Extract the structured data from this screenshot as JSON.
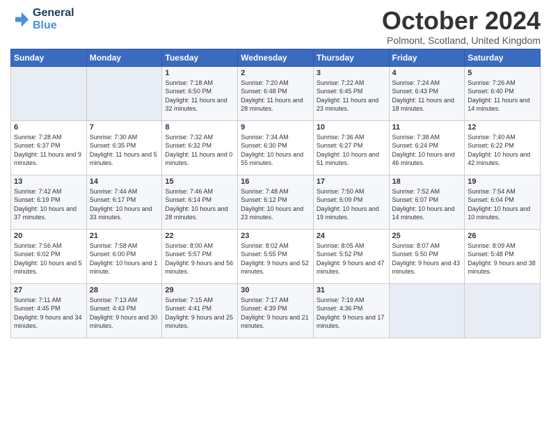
{
  "logo": {
    "line1": "General",
    "line2": "Blue"
  },
  "title": "October 2024",
  "subtitle": "Polmont, Scotland, United Kingdom",
  "weekdays": [
    "Sunday",
    "Monday",
    "Tuesday",
    "Wednesday",
    "Thursday",
    "Friday",
    "Saturday"
  ],
  "weeks": [
    [
      {
        "day": "",
        "empty": true
      },
      {
        "day": "",
        "empty": true
      },
      {
        "day": "1",
        "sunrise": "Sunrise: 7:18 AM",
        "sunset": "Sunset: 6:50 PM",
        "daylight": "Daylight: 11 hours and 32 minutes."
      },
      {
        "day": "2",
        "sunrise": "Sunrise: 7:20 AM",
        "sunset": "Sunset: 6:48 PM",
        "daylight": "Daylight: 11 hours and 28 minutes."
      },
      {
        "day": "3",
        "sunrise": "Sunrise: 7:22 AM",
        "sunset": "Sunset: 6:45 PM",
        "daylight": "Daylight: 11 hours and 23 minutes."
      },
      {
        "day": "4",
        "sunrise": "Sunrise: 7:24 AM",
        "sunset": "Sunset: 6:43 PM",
        "daylight": "Daylight: 11 hours and 18 minutes."
      },
      {
        "day": "5",
        "sunrise": "Sunrise: 7:26 AM",
        "sunset": "Sunset: 6:40 PM",
        "daylight": "Daylight: 11 hours and 14 minutes."
      }
    ],
    [
      {
        "day": "6",
        "sunrise": "Sunrise: 7:28 AM",
        "sunset": "Sunset: 6:37 PM",
        "daylight": "Daylight: 11 hours and 9 minutes."
      },
      {
        "day": "7",
        "sunrise": "Sunrise: 7:30 AM",
        "sunset": "Sunset: 6:35 PM",
        "daylight": "Daylight: 11 hours and 5 minutes."
      },
      {
        "day": "8",
        "sunrise": "Sunrise: 7:32 AM",
        "sunset": "Sunset: 6:32 PM",
        "daylight": "Daylight: 11 hours and 0 minutes."
      },
      {
        "day": "9",
        "sunrise": "Sunrise: 7:34 AM",
        "sunset": "Sunset: 6:30 PM",
        "daylight": "Daylight: 10 hours and 55 minutes."
      },
      {
        "day": "10",
        "sunrise": "Sunrise: 7:36 AM",
        "sunset": "Sunset: 6:27 PM",
        "daylight": "Daylight: 10 hours and 51 minutes."
      },
      {
        "day": "11",
        "sunrise": "Sunrise: 7:38 AM",
        "sunset": "Sunset: 6:24 PM",
        "daylight": "Daylight: 10 hours and 46 minutes."
      },
      {
        "day": "12",
        "sunrise": "Sunrise: 7:40 AM",
        "sunset": "Sunset: 6:22 PM",
        "daylight": "Daylight: 10 hours and 42 minutes."
      }
    ],
    [
      {
        "day": "13",
        "sunrise": "Sunrise: 7:42 AM",
        "sunset": "Sunset: 6:19 PM",
        "daylight": "Daylight: 10 hours and 37 minutes."
      },
      {
        "day": "14",
        "sunrise": "Sunrise: 7:44 AM",
        "sunset": "Sunset: 6:17 PM",
        "daylight": "Daylight: 10 hours and 33 minutes."
      },
      {
        "day": "15",
        "sunrise": "Sunrise: 7:46 AM",
        "sunset": "Sunset: 6:14 PM",
        "daylight": "Daylight: 10 hours and 28 minutes."
      },
      {
        "day": "16",
        "sunrise": "Sunrise: 7:48 AM",
        "sunset": "Sunset: 6:12 PM",
        "daylight": "Daylight: 10 hours and 23 minutes."
      },
      {
        "day": "17",
        "sunrise": "Sunrise: 7:50 AM",
        "sunset": "Sunset: 6:09 PM",
        "daylight": "Daylight: 10 hours and 19 minutes."
      },
      {
        "day": "18",
        "sunrise": "Sunrise: 7:52 AM",
        "sunset": "Sunset: 6:07 PM",
        "daylight": "Daylight: 10 hours and 14 minutes."
      },
      {
        "day": "19",
        "sunrise": "Sunrise: 7:54 AM",
        "sunset": "Sunset: 6:04 PM",
        "daylight": "Daylight: 10 hours and 10 minutes."
      }
    ],
    [
      {
        "day": "20",
        "sunrise": "Sunrise: 7:56 AM",
        "sunset": "Sunset: 6:02 PM",
        "daylight": "Daylight: 10 hours and 5 minutes."
      },
      {
        "day": "21",
        "sunrise": "Sunrise: 7:58 AM",
        "sunset": "Sunset: 6:00 PM",
        "daylight": "Daylight: 10 hours and 1 minute."
      },
      {
        "day": "22",
        "sunrise": "Sunrise: 8:00 AM",
        "sunset": "Sunset: 5:57 PM",
        "daylight": "Daylight: 9 hours and 56 minutes."
      },
      {
        "day": "23",
        "sunrise": "Sunrise: 8:02 AM",
        "sunset": "Sunset: 5:55 PM",
        "daylight": "Daylight: 9 hours and 52 minutes."
      },
      {
        "day": "24",
        "sunrise": "Sunrise: 8:05 AM",
        "sunset": "Sunset: 5:52 PM",
        "daylight": "Daylight: 9 hours and 47 minutes."
      },
      {
        "day": "25",
        "sunrise": "Sunrise: 8:07 AM",
        "sunset": "Sunset: 5:50 PM",
        "daylight": "Daylight: 9 hours and 43 minutes."
      },
      {
        "day": "26",
        "sunrise": "Sunrise: 8:09 AM",
        "sunset": "Sunset: 5:48 PM",
        "daylight": "Daylight: 9 hours and 38 minutes."
      }
    ],
    [
      {
        "day": "27",
        "sunrise": "Sunrise: 7:11 AM",
        "sunset": "Sunset: 4:45 PM",
        "daylight": "Daylight: 9 hours and 34 minutes."
      },
      {
        "day": "28",
        "sunrise": "Sunrise: 7:13 AM",
        "sunset": "Sunset: 4:43 PM",
        "daylight": "Daylight: 9 hours and 30 minutes."
      },
      {
        "day": "29",
        "sunrise": "Sunrise: 7:15 AM",
        "sunset": "Sunset: 4:41 PM",
        "daylight": "Daylight: 9 hours and 25 minutes."
      },
      {
        "day": "30",
        "sunrise": "Sunrise: 7:17 AM",
        "sunset": "Sunset: 4:39 PM",
        "daylight": "Daylight: 9 hours and 21 minutes."
      },
      {
        "day": "31",
        "sunrise": "Sunrise: 7:19 AM",
        "sunset": "Sunset: 4:36 PM",
        "daylight": "Daylight: 9 hours and 17 minutes."
      },
      {
        "day": "",
        "empty": true
      },
      {
        "day": "",
        "empty": true
      }
    ]
  ]
}
